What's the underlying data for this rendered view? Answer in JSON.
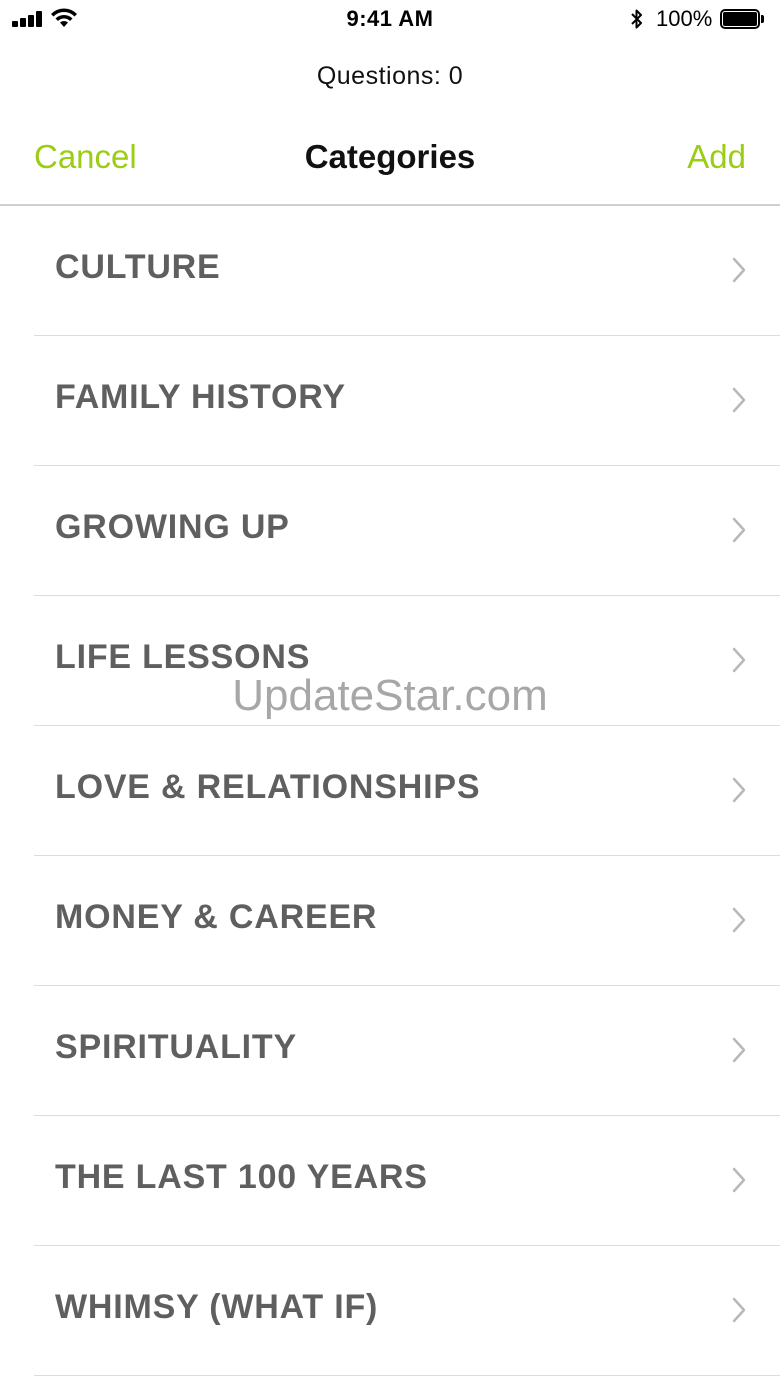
{
  "status_bar": {
    "time": "9:41 AM",
    "battery_percent": "100%",
    "signal_icon": "signal-bars-icon",
    "wifi_icon": "wifi-icon",
    "bluetooth_icon": "bluetooth-icon",
    "battery_icon": "battery-icon"
  },
  "header": {
    "questions_label": "Questions: 0"
  },
  "navbar": {
    "cancel_label": "Cancel",
    "title": "Categories",
    "add_label": "Add"
  },
  "categories": [
    {
      "label": "CULTURE"
    },
    {
      "label": "FAMILY HISTORY"
    },
    {
      "label": "GROWING UP"
    },
    {
      "label": "LIFE LESSONS"
    },
    {
      "label": "LOVE & RELATIONSHIPS"
    },
    {
      "label": "MONEY & CAREER"
    },
    {
      "label": "SPIRITUALITY"
    },
    {
      "label": "THE LAST 100 YEARS"
    },
    {
      "label": "WHIMSY (WHAT IF)"
    }
  ],
  "watermark": "UpdateStar.com",
  "colors": {
    "accent": "#9acd14",
    "item_text": "#5f5f5f",
    "chevron": "#b8b8b8",
    "divider": "#dcdcdc"
  }
}
